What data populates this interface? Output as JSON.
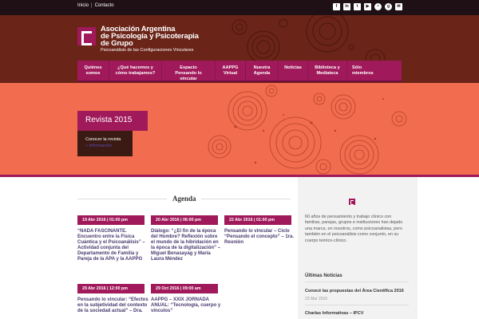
{
  "topbar": {
    "links": [
      "Inicio",
      "Contacto"
    ],
    "separator": "|",
    "social_icons": [
      "facebook-icon",
      "linkedin-icon",
      "twitter-icon",
      "youtube-icon",
      "rss-icon",
      "email-icon",
      "google-icon"
    ]
  },
  "header": {
    "logo_line1": "Asociación Argentina",
    "logo_line2": "de Psicología y Psicoterapia",
    "logo_line3": "de Grupo",
    "logo_sub": "Psicoanálisis de las Configuraciones Vinculares"
  },
  "nav": {
    "items": [
      {
        "line1": "Quiénes",
        "line2": "somos"
      },
      {
        "line1": "¿Qué hacemos y",
        "line2": "cómo trabajamos?"
      },
      {
        "line1": "Espacio",
        "line2": "Pensando lo vincular"
      },
      {
        "line1": "AAPPG",
        "line2": "Virtual"
      },
      {
        "line1": "Nuestra",
        "line2": "Agenda"
      },
      {
        "line1": "Noticias",
        "line2": ""
      },
      {
        "line1": "Biblioteca y",
        "line2": "Mediateca"
      },
      {
        "line1": "Sólo",
        "line2": "miembros"
      }
    ]
  },
  "hero": {
    "title": "Revista 2015",
    "box_text": "Conocer la revista",
    "box_link": "» Información"
  },
  "agenda": {
    "title": "Agenda",
    "events": [
      {
        "date": "19 Abr 2016 | 01:00 pm",
        "text": [
          "“NADA FASCINANTE.",
          "Encuentro entre la Física",
          "Cuántica y el Psicoanálisis” –",
          "Actividad conjunta del",
          "Departamento de Familia y",
          "Pareja de la APA y la AAPPG"
        ]
      },
      {
        "date": "20 Abr 2016 | 06:00 pm",
        "text": [
          "Diálogo: “¿El fin de la época",
          "del Hombre? Reflexión sobre",
          "el mundo de la hibridación en",
          "la época de la digitalización” –",
          "Miguel Benasayag y María",
          "Laura Méndez"
        ]
      },
      {
        "date": "22 Abr 2016 | 01:00 pm",
        "text": [
          "Pensando lo vincular – Ciclo",
          "“Pensando el concepto” – 1ra.",
          "Reunión"
        ]
      },
      {
        "date": "29 Abr 2016 | 12:00 pm",
        "text": [
          "Pensando lo vincular: “Efectos",
          "en la subjetividad del contexto",
          "de la sociedad actual” – Dra."
        ]
      },
      {
        "date": "29 Oct 2016 | 09:00 am",
        "text": [
          "AAPPG – XXIX JORNADA",
          "ANUAL: “Tecnología, cuerpo y",
          "vínculos”"
        ]
      }
    ]
  },
  "sidebar": {
    "description": "60 años de pensamiento y trabajo clínico con familias, parejas, grupos e instituciones han dejado una marca, en nosotros, como psicoanalistas, pero también en el psicoanálisis como conjunto, en su cuerpo teórico-clínico.",
    "news_heading": "Últimas Noticias",
    "news": [
      {
        "title": "Conocé las propuestas del Área Científica 2016",
        "date": "23 Mar 2016"
      },
      {
        "title": "Charlas Informativas – IPCV",
        "date": ""
      }
    ]
  },
  "colors": {
    "brand": "#a0195a",
    "header_bg": "#6a2418",
    "hero_bg": "#f26c4f",
    "topbar_bg": "#1e1014"
  }
}
